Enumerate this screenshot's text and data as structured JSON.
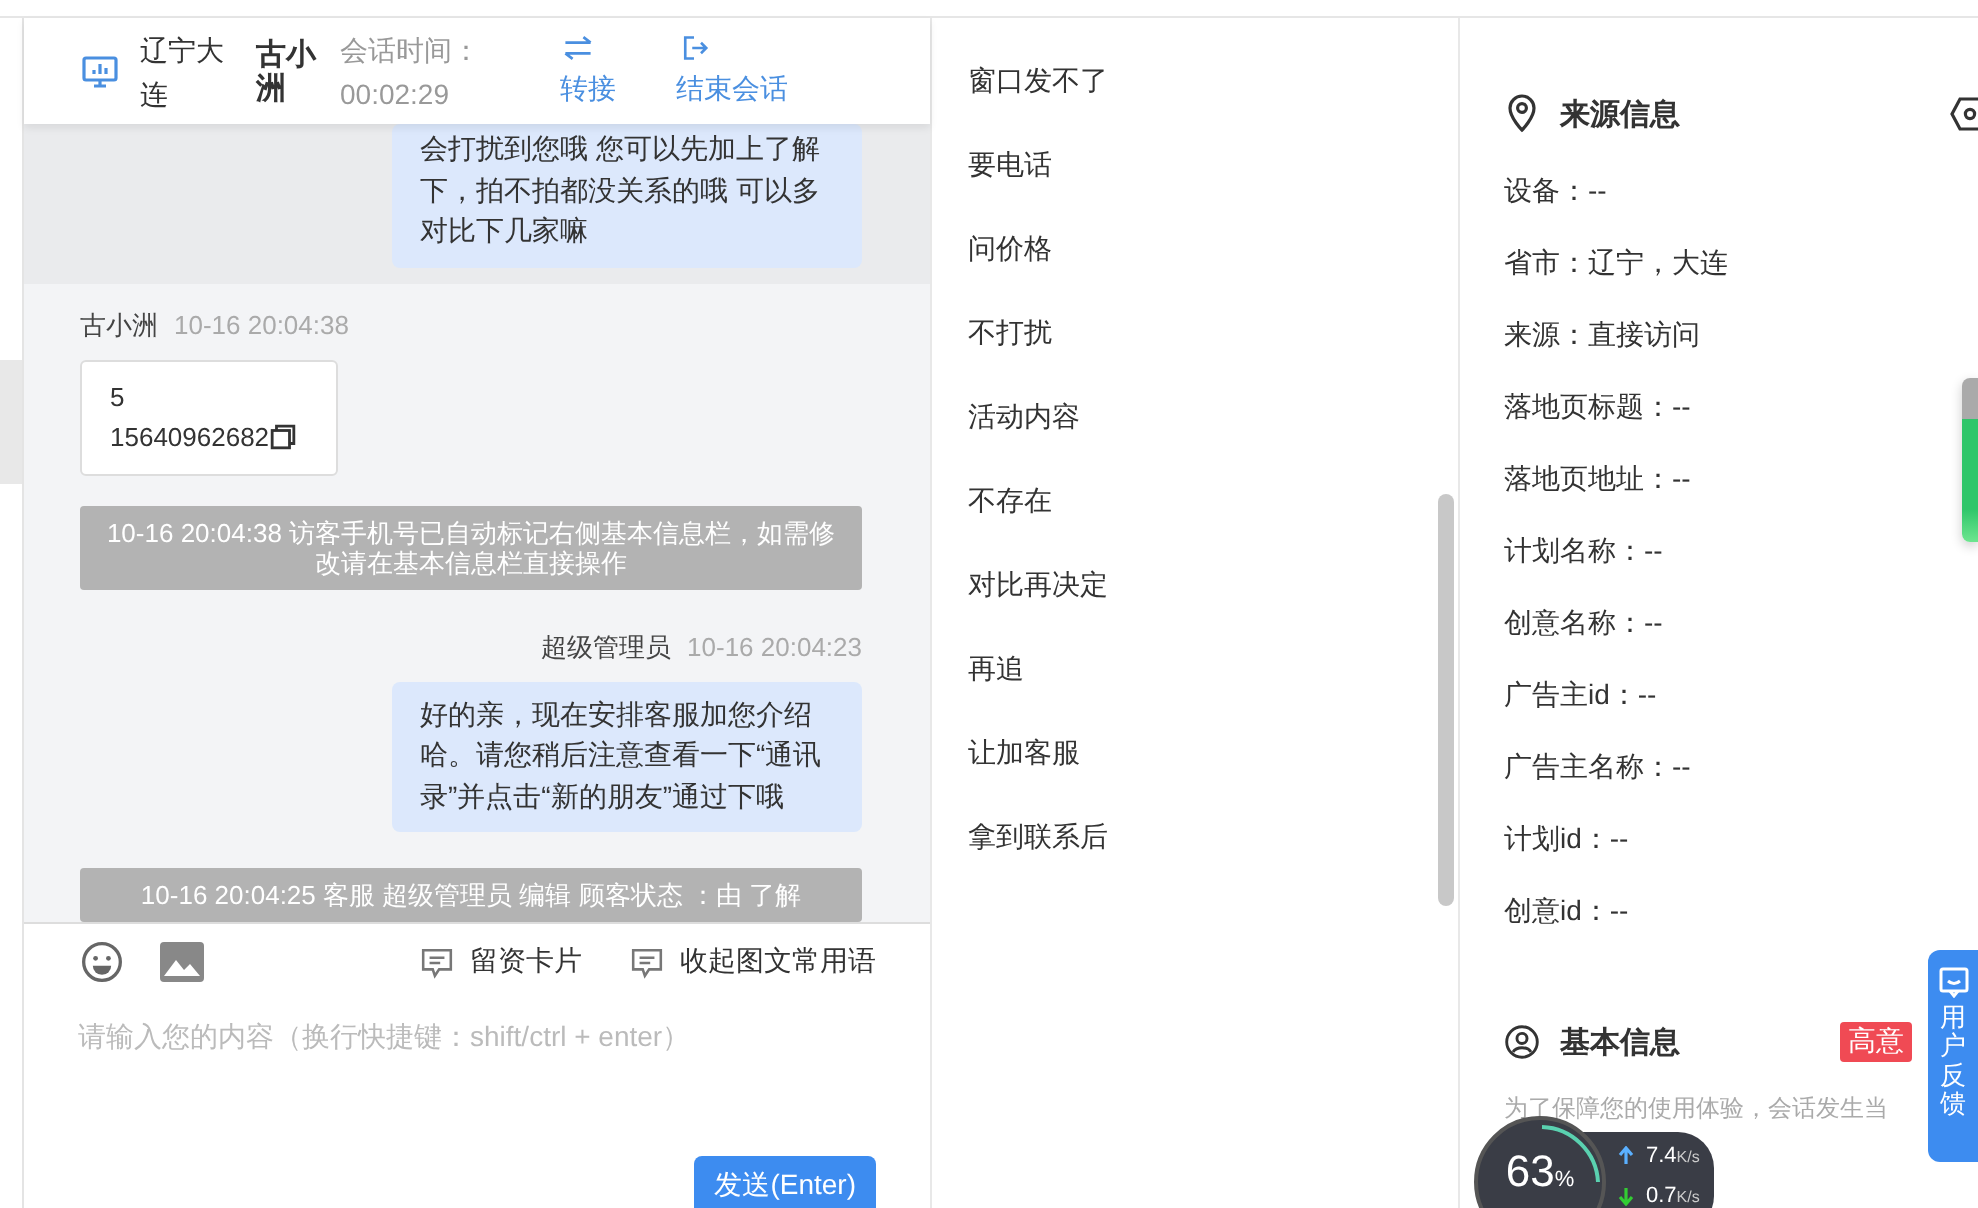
{
  "chat_header": {
    "location": "辽宁大连",
    "visitor": "古小洲",
    "duration_label": "会话时间：",
    "duration": "00:02:29",
    "actions": [
      {
        "kind": "transfer",
        "label": "转接"
      },
      {
        "kind": "end",
        "label": "结束会话"
      }
    ]
  },
  "messages": [
    {
      "kind": "agent",
      "text": "会打扰到您哦 您可以先加上了解下，拍不拍都没关系的哦 可以多对比下几家嘛",
      "highlighted": true
    },
    {
      "kind": "visitor_card",
      "sender": "古小洲",
      "time": "10-16 20:04:38",
      "lines": [
        "5",
        "15640962682"
      ]
    },
    {
      "kind": "system",
      "text": "10-16 20:04:38 访客手机号已自动标记右侧基本信息栏，如需修改请在基本信息栏直接操作"
    },
    {
      "kind": "agent",
      "sender": "超级管理员",
      "time": "10-16 20:04:23",
      "text": "好的亲，现在安排客服加您介绍哈。请您稍后注意查看一下“通讯录”并点击“新的朋友”通过下哦"
    },
    {
      "kind": "system",
      "text": "10-16 20:04:25 客服 超级管理员 编辑 顾客状态 ：由 了解"
    }
  ],
  "composer": {
    "tools": [
      "留资卡片",
      "收起图文常用语"
    ],
    "placeholder": "请输入您的内容（换行快捷键：shift/ctrl + enter）",
    "send_button": "发送(Enter)"
  },
  "quick_replies": [
    "窗口发不了",
    "要电话",
    "问价格",
    "不打扰",
    "活动内容",
    "不存在",
    "对比再决定",
    "再追",
    "让加客服",
    "拿到联系后"
  ],
  "source_info": {
    "title": "来源信息",
    "fields": [
      "设备：--",
      "省市：辽宁，大连",
      "来源：直接访问",
      "落地页标题：--",
      "落地页地址：--",
      "计划名称：--",
      "创意名称：--",
      "广告主id：--",
      "广告主名称：--",
      "计划id：--",
      "创意id：--"
    ]
  },
  "basic_info": {
    "title": "基本信息",
    "tag": "高意",
    "notice": "为了保障您的使用体验，会话发生当"
  },
  "feedback_tab": "用户反馈",
  "speed_widget": {
    "percent": "63",
    "percent_unit": "%",
    "upload": "7.4",
    "upload_unit": "K/s",
    "download": "0.7",
    "download_unit": "K/s"
  }
}
